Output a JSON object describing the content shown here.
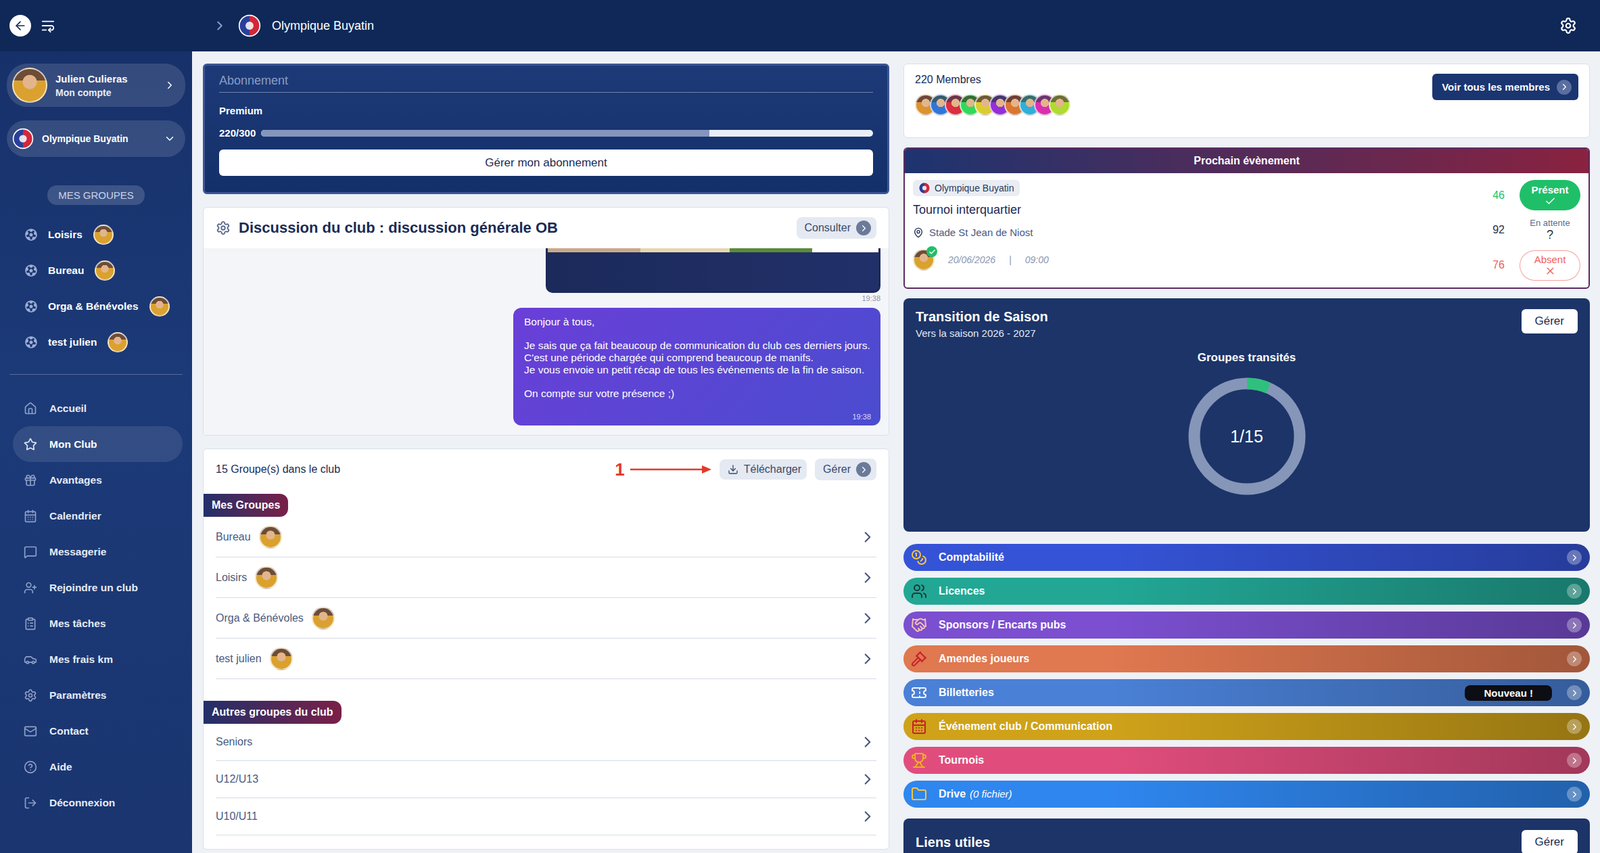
{
  "header": {
    "club_name": "Olympique Buyatin"
  },
  "account": {
    "name": "Julien Culieras",
    "subtitle": "Mon compte"
  },
  "club_selector": {
    "name": "Olympique Buyatin"
  },
  "groups_heading": "MES GROUPES",
  "my_groups": [
    {
      "label": "Loisirs"
    },
    {
      "label": "Bureau"
    },
    {
      "label": "Orga & Bénévoles"
    },
    {
      "label": "test julien"
    }
  ],
  "nav": [
    {
      "label": "Accueil",
      "selected": false
    },
    {
      "label": "Mon Club",
      "selected": true
    },
    {
      "label": "Avantages",
      "selected": false
    },
    {
      "label": "Calendrier",
      "selected": false
    },
    {
      "label": "Messagerie",
      "selected": false
    },
    {
      "label": "Rejoindre un club",
      "selected": false
    },
    {
      "label": "Mes tâches",
      "selected": false
    },
    {
      "label": "Mes frais km",
      "selected": false
    },
    {
      "label": "Paramètres",
      "selected": false
    },
    {
      "label": "Contact",
      "selected": false
    },
    {
      "label": "Aide",
      "selected": false
    },
    {
      "label": "Déconnexion",
      "selected": false
    }
  ],
  "subscription": {
    "title": "Abonnement",
    "plan": "Premium",
    "count": "220/300",
    "level": 0.733,
    "button": "Gérer mon abonnement"
  },
  "discussion": {
    "title": "Discussion du club : discussion générale OB",
    "button": "Consulter",
    "image_time": "19:38",
    "message": {
      "paragraphs": [
        [
          "Bonjour à tous,"
        ],
        [
          "Je sais que ça fait beaucoup de communication du club ces derniers jours.",
          "C'est une période chargée qui comprend beaucoup de manifs.",
          "Je vous envoie un petit récap de tous les événements de la fin de saison."
        ],
        [
          "On compte sur votre présence ;)"
        ]
      ],
      "time": "19:38"
    }
  },
  "groups": {
    "count": "15 Groupe(s) dans le club",
    "annotation": "1",
    "download": "Télécharger",
    "manage": "Gérer",
    "mine_heading": "Mes Groupes",
    "mine": [
      {
        "label": "Bureau"
      },
      {
        "label": "Loisirs"
      },
      {
        "label": "Orga & Bénévoles"
      },
      {
        "label": "test julien"
      }
    ],
    "others_heading": "Autres groupes du club",
    "others": [
      {
        "label": "Seniors"
      },
      {
        "label": "U12/U13"
      },
      {
        "label": "U10/U11"
      }
    ]
  },
  "members": {
    "count": "220 Membres",
    "button": "Voir tous les membres"
  },
  "next_event": {
    "heading": "Prochain évènement",
    "club": "Olympique Buyatin",
    "title": "Tournoi interquartier",
    "place": "Stade St Jean de Niost",
    "date": "20/06/2026",
    "separator": "|",
    "time": "09:00",
    "organizer_confirmed": true,
    "responses": [
      {
        "kind": "present",
        "label": "Présent",
        "count": "46",
        "selected": true,
        "color": "#1fbf6a"
      },
      {
        "kind": "pending",
        "label": "En attente",
        "mark": "?",
        "count": "92",
        "selected": false,
        "color": "#2a2f45"
      },
      {
        "kind": "absent",
        "label": "Absent",
        "count": "76",
        "selected": false,
        "color": "#f0605a"
      }
    ]
  },
  "season": {
    "title": "Transition de Saison",
    "subtitle": "Vers la saison 2026 - 2027",
    "button": "Gérer",
    "chart_title": "Groupes transités",
    "value": "1/15",
    "level": 0.0667
  },
  "modules": [
    {
      "label": "Comptabilité",
      "color": "#3553d6"
    },
    {
      "label": "Licences",
      "color": "#22a795"
    },
    {
      "label": "Sponsors / Encarts pubs",
      "color": "#7b4fd0"
    },
    {
      "label": "Amendes joueurs",
      "color": "#e07850"
    },
    {
      "label": "Billetteries",
      "color": "#4a80d6",
      "badge": "Nouveau !"
    },
    {
      "label": "Événement club / Communication",
      "color": "#cfa21a"
    },
    {
      "label": "Tournois",
      "color": "#e04d7c"
    },
    {
      "label": "Drive",
      "note": "(0 fichier)",
      "color": "#2f86ee"
    }
  ],
  "links": {
    "title": "Liens utiles",
    "button": "Gérer"
  }
}
